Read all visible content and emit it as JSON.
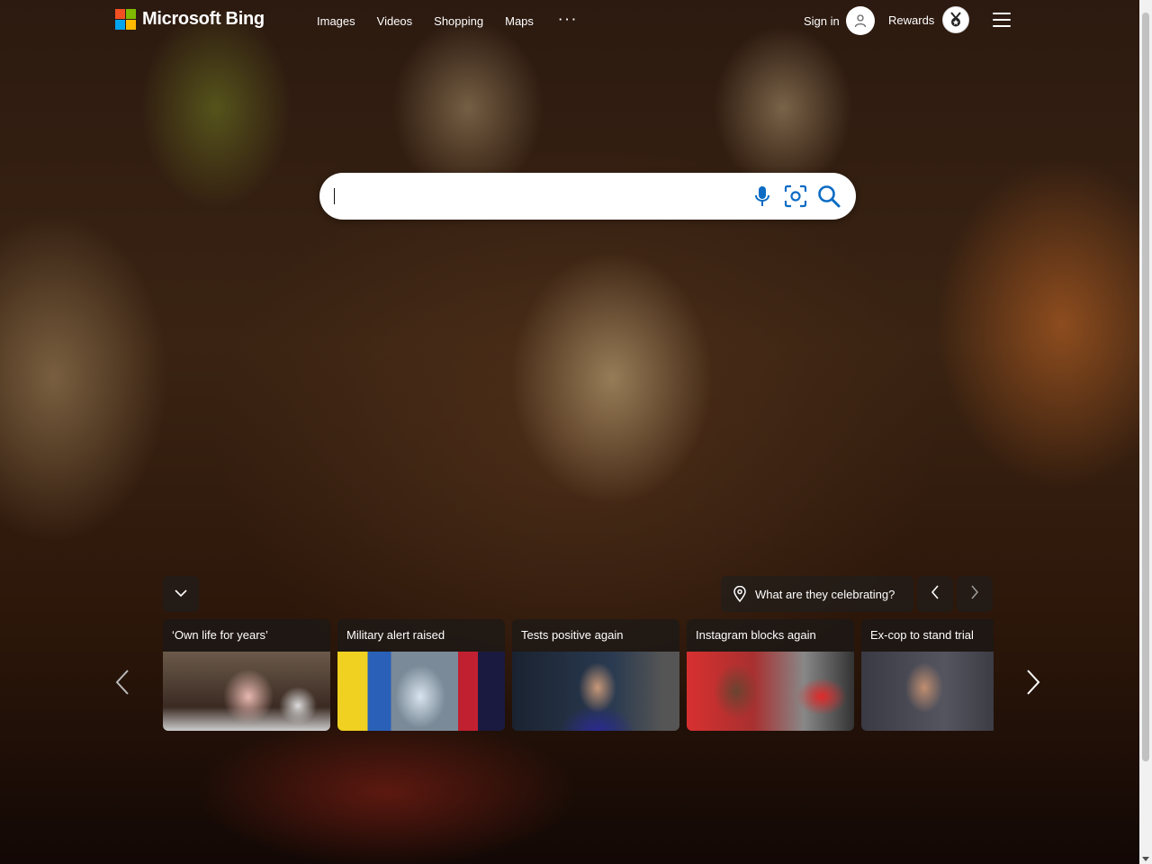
{
  "header": {
    "brand": "Microsoft Bing",
    "nav": [
      "Images",
      "Videos",
      "Shopping",
      "Maps"
    ],
    "more": "···",
    "signin": "Sign in",
    "rewards": "Rewards"
  },
  "search": {
    "value": "",
    "placeholder": ""
  },
  "image_caption": "What are they celebrating?",
  "news": [
    {
      "title": "‘Own life for years’"
    },
    {
      "title": "Military alert raised"
    },
    {
      "title": "Tests positive again"
    },
    {
      "title": "Instagram blocks again"
    },
    {
      "title": "Ex-cop to stand trial"
    }
  ],
  "colors": {
    "ms_red": "#f25022",
    "ms_green": "#7fba00",
    "ms_blue": "#00a4ef",
    "ms_yellow": "#ffb900",
    "search_icon_blue": "#0c6cc4"
  },
  "icons": [
    "microphone-icon",
    "visual-search-icon",
    "search-icon",
    "location-pin-icon",
    "chevron-down-icon",
    "chevron-left-icon",
    "chevron-right-icon",
    "menu-icon",
    "user-icon",
    "rewards-medal-icon"
  ]
}
